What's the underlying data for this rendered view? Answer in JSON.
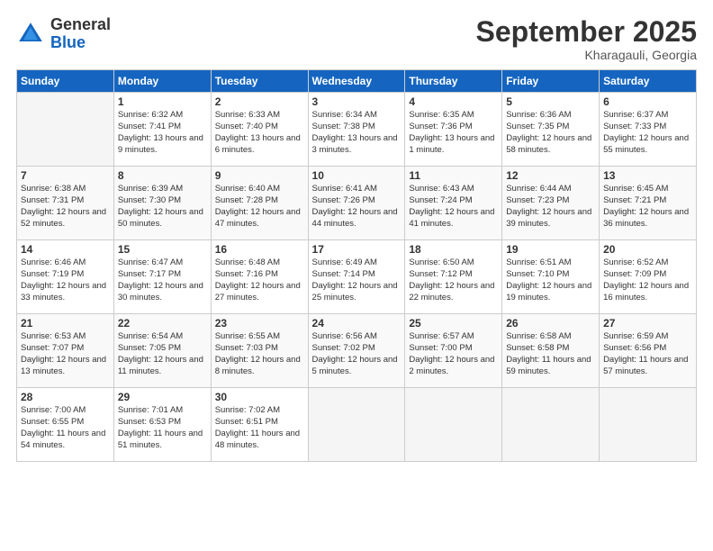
{
  "logo": {
    "general": "General",
    "blue": "Blue"
  },
  "header": {
    "month": "September 2025",
    "location": "Kharagauli, Georgia"
  },
  "weekdays": [
    "Sunday",
    "Monday",
    "Tuesday",
    "Wednesday",
    "Thursday",
    "Friday",
    "Saturday"
  ],
  "weeks": [
    [
      {
        "day": "",
        "sunrise": "",
        "sunset": "",
        "daylight": ""
      },
      {
        "day": "1",
        "sunrise": "Sunrise: 6:32 AM",
        "sunset": "Sunset: 7:41 PM",
        "daylight": "Daylight: 13 hours and 9 minutes."
      },
      {
        "day": "2",
        "sunrise": "Sunrise: 6:33 AM",
        "sunset": "Sunset: 7:40 PM",
        "daylight": "Daylight: 13 hours and 6 minutes."
      },
      {
        "day": "3",
        "sunrise": "Sunrise: 6:34 AM",
        "sunset": "Sunset: 7:38 PM",
        "daylight": "Daylight: 13 hours and 3 minutes."
      },
      {
        "day": "4",
        "sunrise": "Sunrise: 6:35 AM",
        "sunset": "Sunset: 7:36 PM",
        "daylight": "Daylight: 13 hours and 1 minute."
      },
      {
        "day": "5",
        "sunrise": "Sunrise: 6:36 AM",
        "sunset": "Sunset: 7:35 PM",
        "daylight": "Daylight: 12 hours and 58 minutes."
      },
      {
        "day": "6",
        "sunrise": "Sunrise: 6:37 AM",
        "sunset": "Sunset: 7:33 PM",
        "daylight": "Daylight: 12 hours and 55 minutes."
      }
    ],
    [
      {
        "day": "7",
        "sunrise": "Sunrise: 6:38 AM",
        "sunset": "Sunset: 7:31 PM",
        "daylight": "Daylight: 12 hours and 52 minutes."
      },
      {
        "day": "8",
        "sunrise": "Sunrise: 6:39 AM",
        "sunset": "Sunset: 7:30 PM",
        "daylight": "Daylight: 12 hours and 50 minutes."
      },
      {
        "day": "9",
        "sunrise": "Sunrise: 6:40 AM",
        "sunset": "Sunset: 7:28 PM",
        "daylight": "Daylight: 12 hours and 47 minutes."
      },
      {
        "day": "10",
        "sunrise": "Sunrise: 6:41 AM",
        "sunset": "Sunset: 7:26 PM",
        "daylight": "Daylight: 12 hours and 44 minutes."
      },
      {
        "day": "11",
        "sunrise": "Sunrise: 6:43 AM",
        "sunset": "Sunset: 7:24 PM",
        "daylight": "Daylight: 12 hours and 41 minutes."
      },
      {
        "day": "12",
        "sunrise": "Sunrise: 6:44 AM",
        "sunset": "Sunset: 7:23 PM",
        "daylight": "Daylight: 12 hours and 39 minutes."
      },
      {
        "day": "13",
        "sunrise": "Sunrise: 6:45 AM",
        "sunset": "Sunset: 7:21 PM",
        "daylight": "Daylight: 12 hours and 36 minutes."
      }
    ],
    [
      {
        "day": "14",
        "sunrise": "Sunrise: 6:46 AM",
        "sunset": "Sunset: 7:19 PM",
        "daylight": "Daylight: 12 hours and 33 minutes."
      },
      {
        "day": "15",
        "sunrise": "Sunrise: 6:47 AM",
        "sunset": "Sunset: 7:17 PM",
        "daylight": "Daylight: 12 hours and 30 minutes."
      },
      {
        "day": "16",
        "sunrise": "Sunrise: 6:48 AM",
        "sunset": "Sunset: 7:16 PM",
        "daylight": "Daylight: 12 hours and 27 minutes."
      },
      {
        "day": "17",
        "sunrise": "Sunrise: 6:49 AM",
        "sunset": "Sunset: 7:14 PM",
        "daylight": "Daylight: 12 hours and 25 minutes."
      },
      {
        "day": "18",
        "sunrise": "Sunrise: 6:50 AM",
        "sunset": "Sunset: 7:12 PM",
        "daylight": "Daylight: 12 hours and 22 minutes."
      },
      {
        "day": "19",
        "sunrise": "Sunrise: 6:51 AM",
        "sunset": "Sunset: 7:10 PM",
        "daylight": "Daylight: 12 hours and 19 minutes."
      },
      {
        "day": "20",
        "sunrise": "Sunrise: 6:52 AM",
        "sunset": "Sunset: 7:09 PM",
        "daylight": "Daylight: 12 hours and 16 minutes."
      }
    ],
    [
      {
        "day": "21",
        "sunrise": "Sunrise: 6:53 AM",
        "sunset": "Sunset: 7:07 PM",
        "daylight": "Daylight: 12 hours and 13 minutes."
      },
      {
        "day": "22",
        "sunrise": "Sunrise: 6:54 AM",
        "sunset": "Sunset: 7:05 PM",
        "daylight": "Daylight: 12 hours and 11 minutes."
      },
      {
        "day": "23",
        "sunrise": "Sunrise: 6:55 AM",
        "sunset": "Sunset: 7:03 PM",
        "daylight": "Daylight: 12 hours and 8 minutes."
      },
      {
        "day": "24",
        "sunrise": "Sunrise: 6:56 AM",
        "sunset": "Sunset: 7:02 PM",
        "daylight": "Daylight: 12 hours and 5 minutes."
      },
      {
        "day": "25",
        "sunrise": "Sunrise: 6:57 AM",
        "sunset": "Sunset: 7:00 PM",
        "daylight": "Daylight: 12 hours and 2 minutes."
      },
      {
        "day": "26",
        "sunrise": "Sunrise: 6:58 AM",
        "sunset": "Sunset: 6:58 PM",
        "daylight": "Daylight: 11 hours and 59 minutes."
      },
      {
        "day": "27",
        "sunrise": "Sunrise: 6:59 AM",
        "sunset": "Sunset: 6:56 PM",
        "daylight": "Daylight: 11 hours and 57 minutes."
      }
    ],
    [
      {
        "day": "28",
        "sunrise": "Sunrise: 7:00 AM",
        "sunset": "Sunset: 6:55 PM",
        "daylight": "Daylight: 11 hours and 54 minutes."
      },
      {
        "day": "29",
        "sunrise": "Sunrise: 7:01 AM",
        "sunset": "Sunset: 6:53 PM",
        "daylight": "Daylight: 11 hours and 51 minutes."
      },
      {
        "day": "30",
        "sunrise": "Sunrise: 7:02 AM",
        "sunset": "Sunset: 6:51 PM",
        "daylight": "Daylight: 11 hours and 48 minutes."
      },
      {
        "day": "",
        "sunrise": "",
        "sunset": "",
        "daylight": ""
      },
      {
        "day": "",
        "sunrise": "",
        "sunset": "",
        "daylight": ""
      },
      {
        "day": "",
        "sunrise": "",
        "sunset": "",
        "daylight": ""
      },
      {
        "day": "",
        "sunrise": "",
        "sunset": "",
        "daylight": ""
      }
    ]
  ]
}
